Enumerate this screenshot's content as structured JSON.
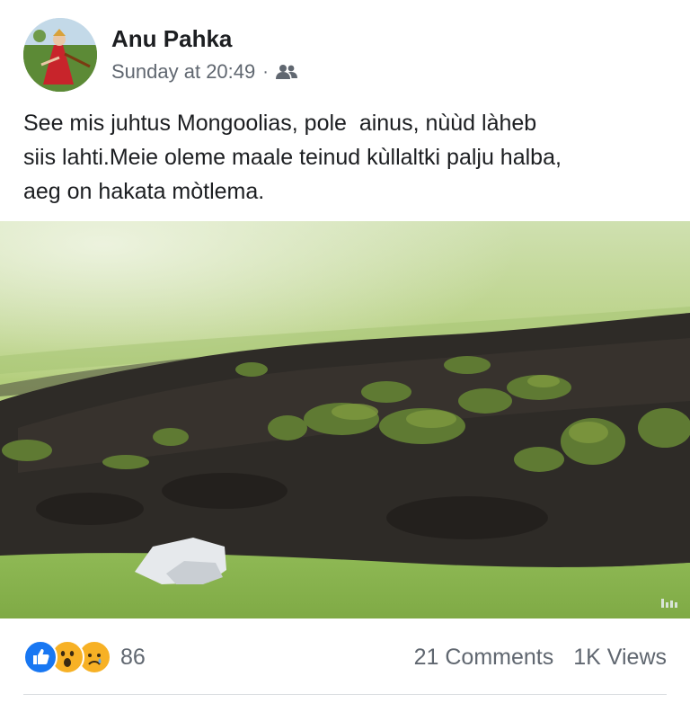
{
  "post": {
    "author": "Anu Pahka",
    "timestamp": "Sunday at 20:49",
    "separator": "·",
    "audience_icon": "friends-icon",
    "text": "See mis juhtus Mongoolias, pole  ainus, nùùd làheb\nsiis lahti.Meie oleme maale teinud kùllaltki palju halba,\naeg on hakata mòtlema.",
    "photo_icon": "landscape-photo"
  },
  "footer": {
    "reaction_icons": [
      "like-icon",
      "wow-icon",
      "sad-icon"
    ],
    "reaction_count": "86",
    "comments": "21 Comments",
    "views": "1K Views"
  },
  "colors": {
    "like_blue": "#1877f2",
    "reaction_yellow": "#f7b125",
    "secondary_text": "#606770",
    "divider": "#dadde1"
  }
}
